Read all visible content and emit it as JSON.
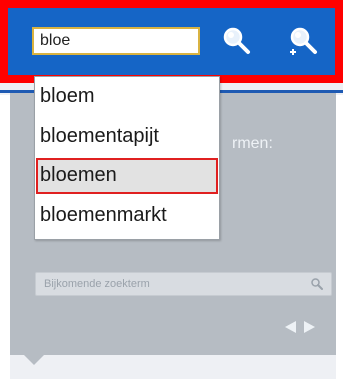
{
  "search": {
    "value": "bloe"
  },
  "icons": {
    "search": "search-icon",
    "advanced_search": "zoom-plus-icon",
    "mini_search": "search-icon",
    "nav": "arrow-left-right-icon"
  },
  "dropdown": {
    "items": [
      "bloem",
      "bloementapijt",
      "bloemen",
      "bloemenmarkt"
    ],
    "selected": "bloemen"
  },
  "panel": {
    "label_fragment": "rmen:",
    "extra_term_placeholder": "Bijkomende zoekterm"
  },
  "colors": {
    "highlight_border": "#ff0000",
    "bar_blue": "#1565c6",
    "panel_grey": "#b6bcc3"
  }
}
